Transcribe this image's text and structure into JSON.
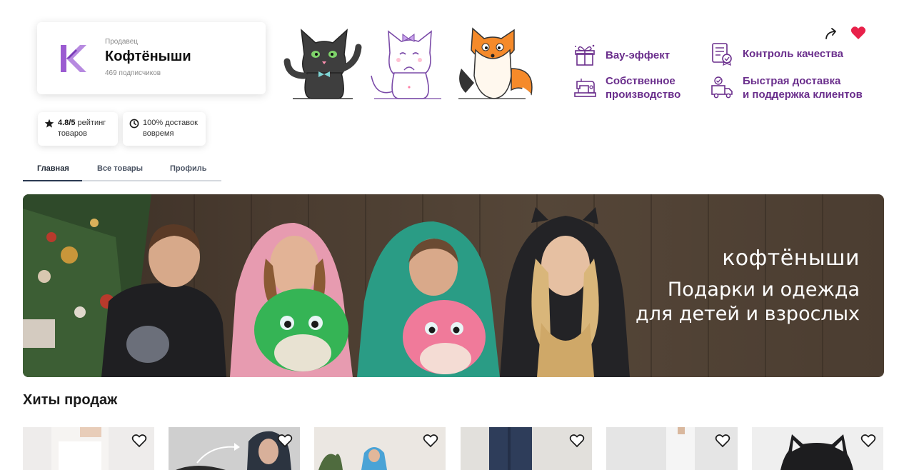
{
  "seller": {
    "role": "Продавец",
    "name": "Кофтёныши",
    "subscribers": "469 подписчиков",
    "logo_color": "#9b5bd1"
  },
  "stats": {
    "rating_value": "4.8/5",
    "rating_text": "рейтинг",
    "rating_line2": "товаров",
    "delivery_text": "100% доставок",
    "delivery_line2": "вовремя"
  },
  "tabs": [
    {
      "label": "Главная",
      "active": true
    },
    {
      "label": "Все товары",
      "active": false
    },
    {
      "label": "Профиль",
      "active": false
    }
  ],
  "features": [
    {
      "label": "Вау-эффект",
      "icon": "gift-icon"
    },
    {
      "label_line1": "Контроль качества",
      "icon": "quality-certificate-icon"
    },
    {
      "label_line1": "Собственное",
      "label_line2": "производство",
      "icon": "sewing-machine-icon"
    },
    {
      "label_line1": "Быстрая доставка",
      "label_line2": "и поддержка клиентов",
      "icon": "delivery-truck-icon"
    }
  ],
  "banner": {
    "brand": "кофтёныши",
    "line1": "Подарки и одежда",
    "line2": "для детей и взрослых"
  },
  "section": {
    "title": "Хиты продаж"
  },
  "colors": {
    "accent_purple": "#6a2e8c",
    "heart_red": "#e8214a",
    "tab_active": "#2b3a52"
  },
  "products": [
    {
      "name": "product-1"
    },
    {
      "name": "product-2"
    },
    {
      "name": "product-3"
    },
    {
      "name": "product-4"
    },
    {
      "name": "product-5"
    },
    {
      "name": "product-6"
    }
  ]
}
